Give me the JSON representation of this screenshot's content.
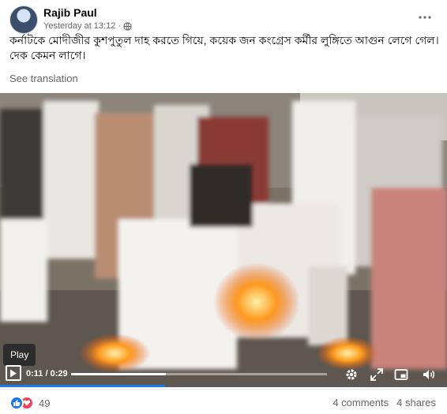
{
  "post": {
    "author": "Rajib Paul",
    "timestamp": "Yesterday at 13:12",
    "privacy_icon": "globe-icon",
    "caption": "কর্নাটকে মোদীজীর কুশপুতুল দাহ করতে গিয়ে, কয়েক জন কংগ্রেস কর্মীর লুঙ্গিতে আগুন লেগে গেল। দেক কেমন লাগে।",
    "see_translation": "See translation",
    "more_icon": "more-options-icon"
  },
  "video": {
    "tooltip": "Play",
    "current_time": "0:11",
    "separator": " / ",
    "duration": "0:29",
    "progress_fraction": 0.37,
    "accent_color": "#1877f2",
    "controls_icons": [
      "play-icon",
      "settings-icon",
      "fullscreen-icon",
      "pip-icon",
      "volume-icon"
    ]
  },
  "footer": {
    "reaction_count": "49",
    "reaction_icons": [
      "like-icon",
      "love-icon"
    ],
    "comments": "4 comments",
    "shares": "4 shares"
  }
}
